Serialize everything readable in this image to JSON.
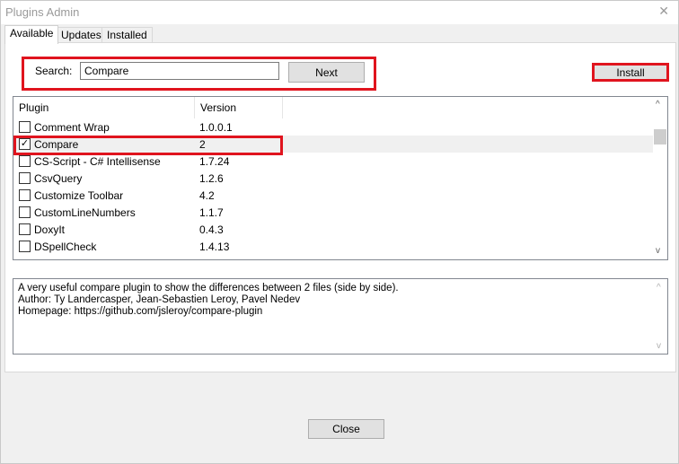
{
  "window": {
    "title": "Plugins Admin",
    "close_glyph": "✕"
  },
  "tabs": [
    {
      "label": "Available",
      "active": true
    },
    {
      "label": "Updates",
      "active": false
    },
    {
      "label": "Installed",
      "active": false
    }
  ],
  "search": {
    "label": "Search:",
    "value": "Compare",
    "next_label": "Next"
  },
  "install_label": "Install",
  "list": {
    "columns": [
      "Plugin",
      "Version"
    ],
    "rows": [
      {
        "name": "Comment Wrap",
        "version": "1.0.0.1",
        "checked": false
      },
      {
        "name": "Compare",
        "version": "2",
        "checked": true
      },
      {
        "name": "CS-Script - C# Intellisense",
        "version": "1.7.24",
        "checked": false
      },
      {
        "name": "CsvQuery",
        "version": "1.2.6",
        "checked": false
      },
      {
        "name": "Customize Toolbar",
        "version": "4.2",
        "checked": false
      },
      {
        "name": "CustomLineNumbers",
        "version": "1.1.7",
        "checked": false
      },
      {
        "name": "DoxyIt",
        "version": "0.4.3",
        "checked": false
      },
      {
        "name": "DSpellCheck",
        "version": "1.4.13",
        "checked": false
      }
    ]
  },
  "description": {
    "lines": [
      "A very useful compare plugin to show the differences between 2 files (side by side).",
      "Author: Ty Landercasper, Jean-Sebastien Leroy, Pavel Nedev",
      "Homepage: https://github.com/jsleroy/compare-plugin"
    ]
  },
  "close_label": "Close",
  "icons": {
    "checkbox_checked": "✓",
    "scroll_up": "^",
    "scroll_down": "v"
  },
  "colors": {
    "highlight": "#e0141e",
    "button_bg": "#e1e1e1",
    "window_bg": "#f0f0f0"
  }
}
